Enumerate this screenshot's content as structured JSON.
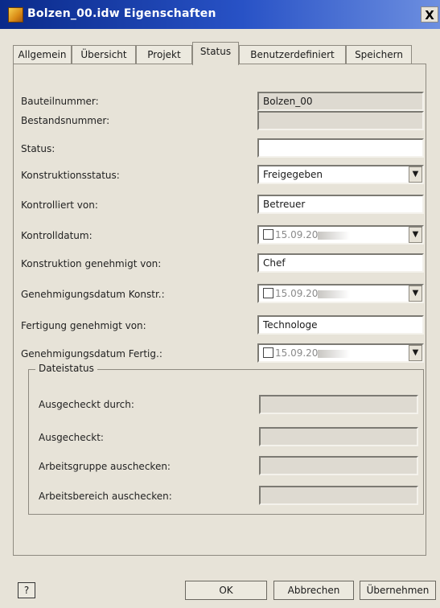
{
  "window": {
    "title": "Bolzen_00.idw Eigenschaften",
    "close": "X"
  },
  "tabs": [
    {
      "label": "Allgemein"
    },
    {
      "label": "Übersicht"
    },
    {
      "label": "Projekt"
    },
    {
      "label": "Status",
      "active": true
    },
    {
      "label": "Benutzerdefiniert"
    },
    {
      "label": "Speichern"
    }
  ],
  "fields": {
    "bauteilnummer": {
      "label": "Bauteilnummer:",
      "value": "Bolzen_00"
    },
    "bestandsnummer": {
      "label": "Bestandsnummer:",
      "value": ""
    },
    "status": {
      "label": "Status:",
      "value": ""
    },
    "konstruktionsstatus": {
      "label": "Konstruktionsstatus:",
      "value": "Freigegeben"
    },
    "kontrolliert_von": {
      "label": "Kontrolliert von:",
      "value": "Betreuer"
    },
    "kontrolldatum": {
      "label": "Kontrolldatum:",
      "value": "15.09.20"
    },
    "konstruktion_genehmigt_von": {
      "label": "Konstruktion genehmigt von:",
      "value": "Chef"
    },
    "genehmigungsdatum_konstr": {
      "label": "Genehmigungsdatum Konstr.:",
      "value": "15.09.20"
    },
    "fertigung_genehmigt_von": {
      "label": "Fertigung genehmigt von:",
      "value": "Technologe"
    },
    "genehmigungsdatum_fertig": {
      "label": "Genehmigungsdatum Fertig.:",
      "value": "15.09.20"
    }
  },
  "dateistatus": {
    "legend": "Dateistatus",
    "ausgecheckt_durch": {
      "label": "Ausgecheckt durch:"
    },
    "ausgecheckt": {
      "label": "Ausgecheckt:"
    },
    "arbeitsgruppe": {
      "label": "Arbeitsgruppe auschecken:"
    },
    "arbeitsbereich": {
      "label": "Arbeitsbereich auschecken:"
    }
  },
  "buttons": {
    "help": "?",
    "ok": "OK",
    "cancel": "Abbrechen",
    "apply": "Übernehmen"
  },
  "icons": {
    "dropdown": "▼"
  }
}
